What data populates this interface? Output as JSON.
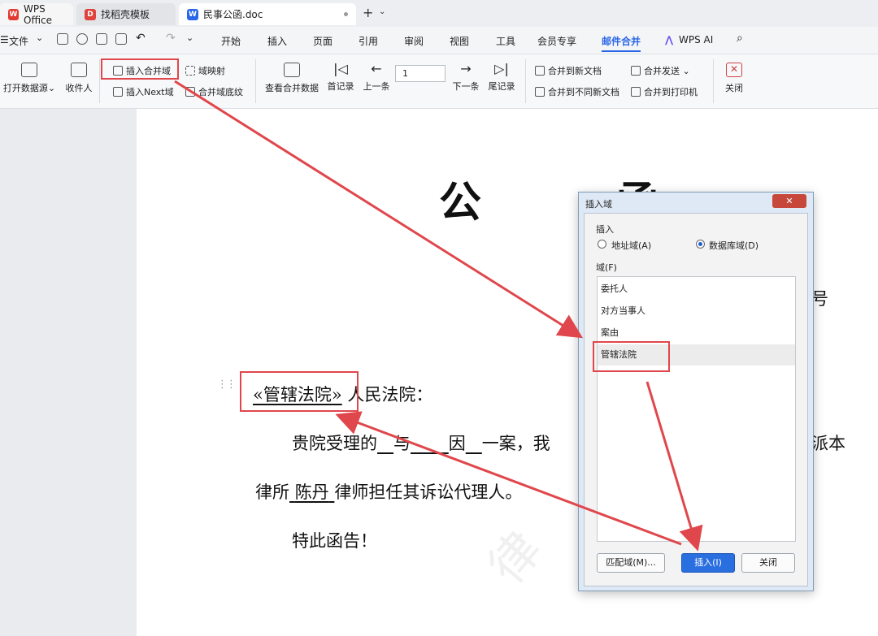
{
  "tabs": [
    {
      "label": "WPS Office",
      "icon": "wps-logo-icon",
      "color": "#e33b30"
    },
    {
      "label": "找稻壳模板",
      "icon": "docer-icon",
      "color": "#e0433c"
    },
    {
      "label": "民事公函.doc",
      "icon": "word-doc-icon",
      "color": "#2a67e8"
    }
  ],
  "menu": {
    "file": "文件",
    "items": [
      "开始",
      "插入",
      "页面",
      "引用",
      "审阅",
      "视图",
      "工具",
      "会员专享",
      "邮件合并",
      "WPS AI"
    ],
    "active": "邮件合并"
  },
  "ribbon": {
    "open_source": "打开数据源",
    "recipients": "收件人",
    "insert_merge_field": "插入合并域",
    "insert_next_field": "插入Next域",
    "field_mapping": "域映射",
    "merge_field_shading": "合并域底纹",
    "view_merged_data": "查看合并数据",
    "first_record": "首记录",
    "prev": "上一条",
    "record_value": "1",
    "next": "下一条",
    "last_record": "尾记录",
    "merge_new_doc": "合并到新文档",
    "merge_diff_docs": "合并到不同新文档",
    "merge_send": "合并发送",
    "merge_printer": "合并到打印机",
    "close": "关闭"
  },
  "document": {
    "title_left": "公",
    "title_right": "函",
    "number_suffix": "号",
    "merge_field": "«管辖法院»",
    "court_suffix": "人民法院：",
    "para1_start": "贵院受理的",
    "para1_mid1": "与",
    "para1_mid2": "因",
    "para1_mid3": "一案，我",
    "para1_end": "派本",
    "para2_start": "律所",
    "lawyer": "陈丹",
    "para2_end": "律师担任其诉讼代理人。",
    "closing": "特此函告！"
  },
  "dialog": {
    "title": "插入域",
    "close_label": "✕",
    "insert_group": "插入",
    "radio_address": "地址域(A)",
    "radio_database": "数据库域(D)",
    "radio_selected": "database",
    "field_label": "域(F)",
    "fields": [
      "委托人",
      "对方当事人",
      "案由",
      "管辖法院"
    ],
    "selected_field": "管辖法院",
    "match_button": "匹配域(M)...",
    "insert_button": "插入(I)",
    "close_button": "关闭"
  },
  "colors": {
    "accent": "#2a67e8",
    "annotation_red": "#e0474c",
    "dialog_close": "#c7473b"
  }
}
